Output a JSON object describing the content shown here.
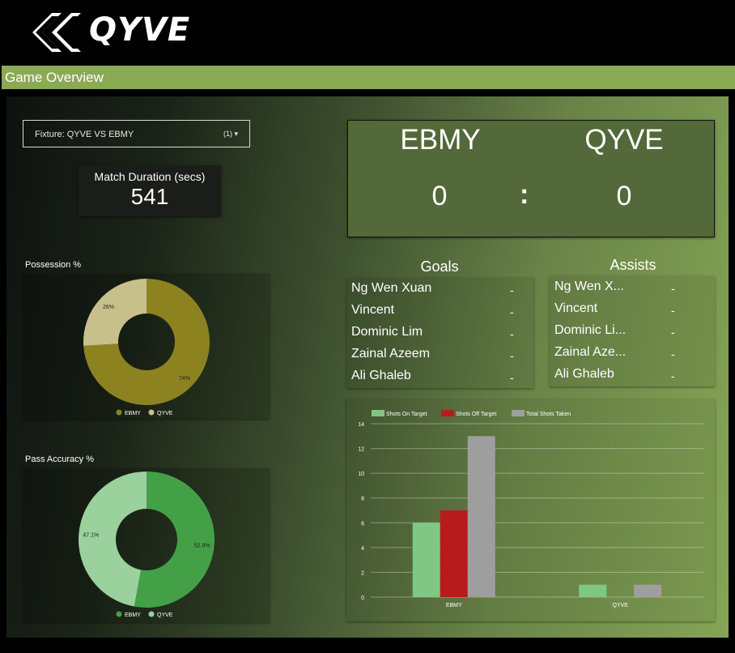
{
  "brand": {
    "name": "QYVE"
  },
  "header": {
    "title": "Game Overview"
  },
  "fixture": {
    "label": "Fixture: QYVE VS EBMY",
    "count": "(1)"
  },
  "duration": {
    "label": "Match Duration (secs)",
    "value": "541"
  },
  "scoreboard": {
    "home_team": "EBMY",
    "away_team": "QYVE",
    "home_score": "0",
    "away_score": "0",
    "separator": ":"
  },
  "goals": {
    "title": "Goals",
    "rows": [
      {
        "player": "Ng Wen Xuan",
        "value": "-"
      },
      {
        "player": "Vincent",
        "value": "-"
      },
      {
        "player": "Dominic Lim",
        "value": "-"
      },
      {
        "player": "Zainal Azeem",
        "value": "-"
      },
      {
        "player": "Ali Ghaleb",
        "value": "-"
      }
    ]
  },
  "assists": {
    "title": "Assists",
    "rows": [
      {
        "player": "Ng Wen X...",
        "value": "-"
      },
      {
        "player": "Vincent",
        "value": "-"
      },
      {
        "player": "Dominic Li...",
        "value": "-"
      },
      {
        "player": "Zainal Aze...",
        "value": "-"
      },
      {
        "player": "Ali Ghaleb",
        "value": "-"
      }
    ]
  },
  "chart_data": [
    {
      "type": "pie",
      "title": "Possession %",
      "donut": true,
      "labels": [
        "EBMY",
        "QYVE"
      ],
      "values": [
        74,
        26
      ],
      "value_labels": [
        "74%",
        "26%"
      ],
      "colors": [
        "#8c8220",
        "#c8c08a"
      ],
      "legend": "bottom"
    },
    {
      "type": "pie",
      "title": "Pass Accuracy %",
      "donut": true,
      "labels": [
        "EBMY",
        "QYVE"
      ],
      "values": [
        52.9,
        47.1
      ],
      "value_labels": [
        "52.9%",
        "47.1%"
      ],
      "colors": [
        "#43a047",
        "#9ad19c"
      ],
      "legend": "bottom"
    },
    {
      "type": "bar",
      "categories": [
        "EBMY",
        "QYVE"
      ],
      "series": [
        {
          "name": "Shots On Target",
          "values": [
            6,
            1
          ],
          "color": "#81c784"
        },
        {
          "name": "Shots Off Target",
          "values": [
            7,
            0
          ],
          "color": "#b71c1c"
        },
        {
          "name": "Total Shots Taken",
          "values": [
            13,
            1
          ],
          "color": "#9e9e9e"
        }
      ],
      "ylim": [
        0,
        14
      ],
      "yticks": [
        0,
        2,
        4,
        6,
        8,
        10,
        12,
        14
      ],
      "grid": true,
      "legend": "top-left"
    }
  ]
}
